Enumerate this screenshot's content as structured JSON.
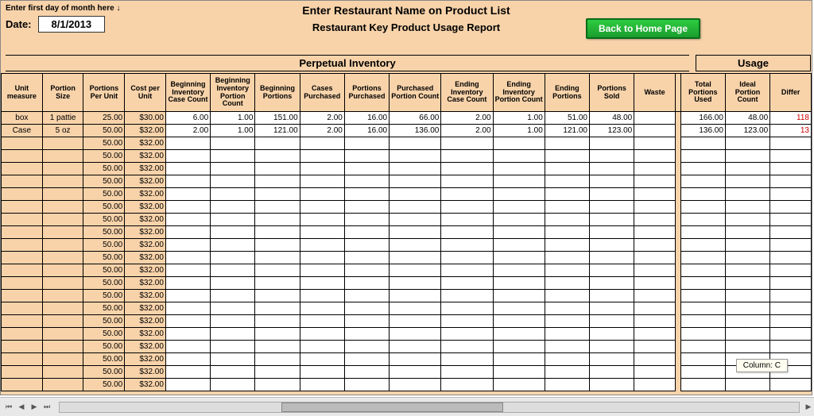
{
  "header": {
    "hint": "Enter first day of month here ↓",
    "title": "Enter Restaurant Name on Product List",
    "date_label": "Date:",
    "date_value": "8/1/2013",
    "subtitle": "Restaurant Key Product Usage Report",
    "home_button": "Back to Home Page",
    "section_perpetual": "Perpetual Inventory",
    "section_usage": "Usage"
  },
  "columns": [
    "Unit measure",
    "Portion Size",
    "Portions Per Unit",
    "Cost per Unit",
    "Beginning Inventory Case Count",
    "Beginning Inventory Portion Count",
    "Beginning Portions",
    "Cases Purchased",
    "Portions Purchased",
    "Purchased Portion Count",
    "Ending Inventory Case Count",
    "Ending Inventory Portion Count",
    "Ending Portions",
    "Portions Sold",
    "Waste",
    "Total Portions Used",
    "Ideal Portion Count",
    "Differ"
  ],
  "rows": [
    {
      "c": [
        "box",
        "1 pattie",
        "25.00",
        "$30.00",
        "6.00",
        "1.00",
        "151.00",
        "2.00",
        "16.00",
        "66.00",
        "2.00",
        "1.00",
        "51.00",
        "48.00",
        "",
        "166.00",
        "48.00",
        "118"
      ]
    },
    {
      "c": [
        "Case",
        "5 oz",
        "50.00",
        "$32.00",
        "2.00",
        "1.00",
        "121.00",
        "2.00",
        "16.00",
        "136.00",
        "2.00",
        "1.00",
        "121.00",
        "123.00",
        "",
        "136.00",
        "123.00",
        "13"
      ]
    },
    {
      "c": [
        "",
        "",
        "50.00",
        "$32.00",
        "",
        "",
        "",
        "",
        "",
        "",
        "",
        "",
        "",
        "",
        "",
        "",
        "",
        ""
      ]
    },
    {
      "c": [
        "",
        "",
        "50.00",
        "$32.00",
        "",
        "",
        "",
        "",
        "",
        "",
        "",
        "",
        "",
        "",
        "",
        "",
        "",
        ""
      ]
    },
    {
      "c": [
        "",
        "",
        "50.00",
        "$32.00",
        "",
        "",
        "",
        "",
        "",
        "",
        "",
        "",
        "",
        "",
        "",
        "",
        "",
        ""
      ]
    },
    {
      "c": [
        "",
        "",
        "50.00",
        "$32.00",
        "",
        "",
        "",
        "",
        "",
        "",
        "",
        "",
        "",
        "",
        "",
        "",
        "",
        ""
      ]
    },
    {
      "c": [
        "",
        "",
        "50.00",
        "$32.00",
        "",
        "",
        "",
        "",
        "",
        "",
        "",
        "",
        "",
        "",
        "",
        "",
        "",
        ""
      ]
    },
    {
      "c": [
        "",
        "",
        "50.00",
        "$32.00",
        "",
        "",
        "",
        "",
        "",
        "",
        "",
        "",
        "",
        "",
        "",
        "",
        "",
        ""
      ]
    },
    {
      "c": [
        "",
        "",
        "50.00",
        "$32.00",
        "",
        "",
        "",
        "",
        "",
        "",
        "",
        "",
        "",
        "",
        "",
        "",
        "",
        ""
      ]
    },
    {
      "c": [
        "",
        "",
        "50.00",
        "$32.00",
        "",
        "",
        "",
        "",
        "",
        "",
        "",
        "",
        "",
        "",
        "",
        "",
        "",
        ""
      ]
    },
    {
      "c": [
        "",
        "",
        "50.00",
        "$32.00",
        "",
        "",
        "",
        "",
        "",
        "",
        "",
        "",
        "",
        "",
        "",
        "",
        "",
        ""
      ]
    },
    {
      "c": [
        "",
        "",
        "50.00",
        "$32.00",
        "",
        "",
        "",
        "",
        "",
        "",
        "",
        "",
        "",
        "",
        "",
        "",
        "",
        ""
      ]
    },
    {
      "c": [
        "",
        "",
        "50.00",
        "$32.00",
        "",
        "",
        "",
        "",
        "",
        "",
        "",
        "",
        "",
        "",
        "",
        "",
        "",
        ""
      ]
    },
    {
      "c": [
        "",
        "",
        "50.00",
        "$32.00",
        "",
        "",
        "",
        "",
        "",
        "",
        "",
        "",
        "",
        "",
        "",
        "",
        "",
        ""
      ]
    },
    {
      "c": [
        "",
        "",
        "50.00",
        "$32.00",
        "",
        "",
        "",
        "",
        "",
        "",
        "",
        "",
        "",
        "",
        "",
        "",
        "",
        ""
      ]
    },
    {
      "c": [
        "",
        "",
        "50.00",
        "$32.00",
        "",
        "",
        "",
        "",
        "",
        "",
        "",
        "",
        "",
        "",
        "",
        "",
        "",
        ""
      ]
    },
    {
      "c": [
        "",
        "",
        "50.00",
        "$32.00",
        "",
        "",
        "",
        "",
        "",
        "",
        "",
        "",
        "",
        "",
        "",
        "",
        "",
        ""
      ]
    },
    {
      "c": [
        "",
        "",
        "50.00",
        "$32.00",
        "",
        "",
        "",
        "",
        "",
        "",
        "",
        "",
        "",
        "",
        "",
        "",
        "",
        ""
      ]
    },
    {
      "c": [
        "",
        "",
        "50.00",
        "$32.00",
        "",
        "",
        "",
        "",
        "",
        "",
        "",
        "",
        "",
        "",
        "",
        "",
        "",
        ""
      ]
    },
    {
      "c": [
        "",
        "",
        "50.00",
        "$32.00",
        "",
        "",
        "",
        "",
        "",
        "",
        "",
        "",
        "",
        "",
        "",
        "",
        "",
        ""
      ]
    },
    {
      "c": [
        "",
        "",
        "50.00",
        "$32.00",
        "",
        "",
        "",
        "",
        "",
        "",
        "",
        "",
        "",
        "",
        "",
        "",
        "",
        ""
      ]
    },
    {
      "c": [
        "",
        "",
        "50.00",
        "$32.00",
        "",
        "",
        "",
        "",
        "",
        "",
        "",
        "",
        "",
        "",
        "",
        "",
        "",
        ""
      ]
    }
  ],
  "status": {
    "column_indicator": "Column: C"
  }
}
